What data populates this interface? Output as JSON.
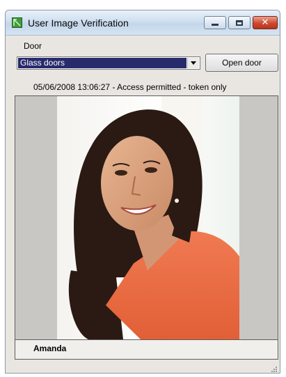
{
  "window": {
    "title": "User Image Verification",
    "minimize_icon": "minimize-icon",
    "maximize_icon": "maximize-icon",
    "close_icon": "close-icon",
    "close_glyph": "✕"
  },
  "door": {
    "label": "Door",
    "selected": "Glass doors",
    "open_button_label": "Open door"
  },
  "event": {
    "status": "05/06/2008  13:06:27 - Access permitted - token only"
  },
  "user": {
    "name": "Amanda",
    "photo": "user-photo"
  },
  "colors": {
    "selection_bg": "#272a6b",
    "window_bg": "#e9e6e2",
    "close_button": "#cc4a2f"
  }
}
